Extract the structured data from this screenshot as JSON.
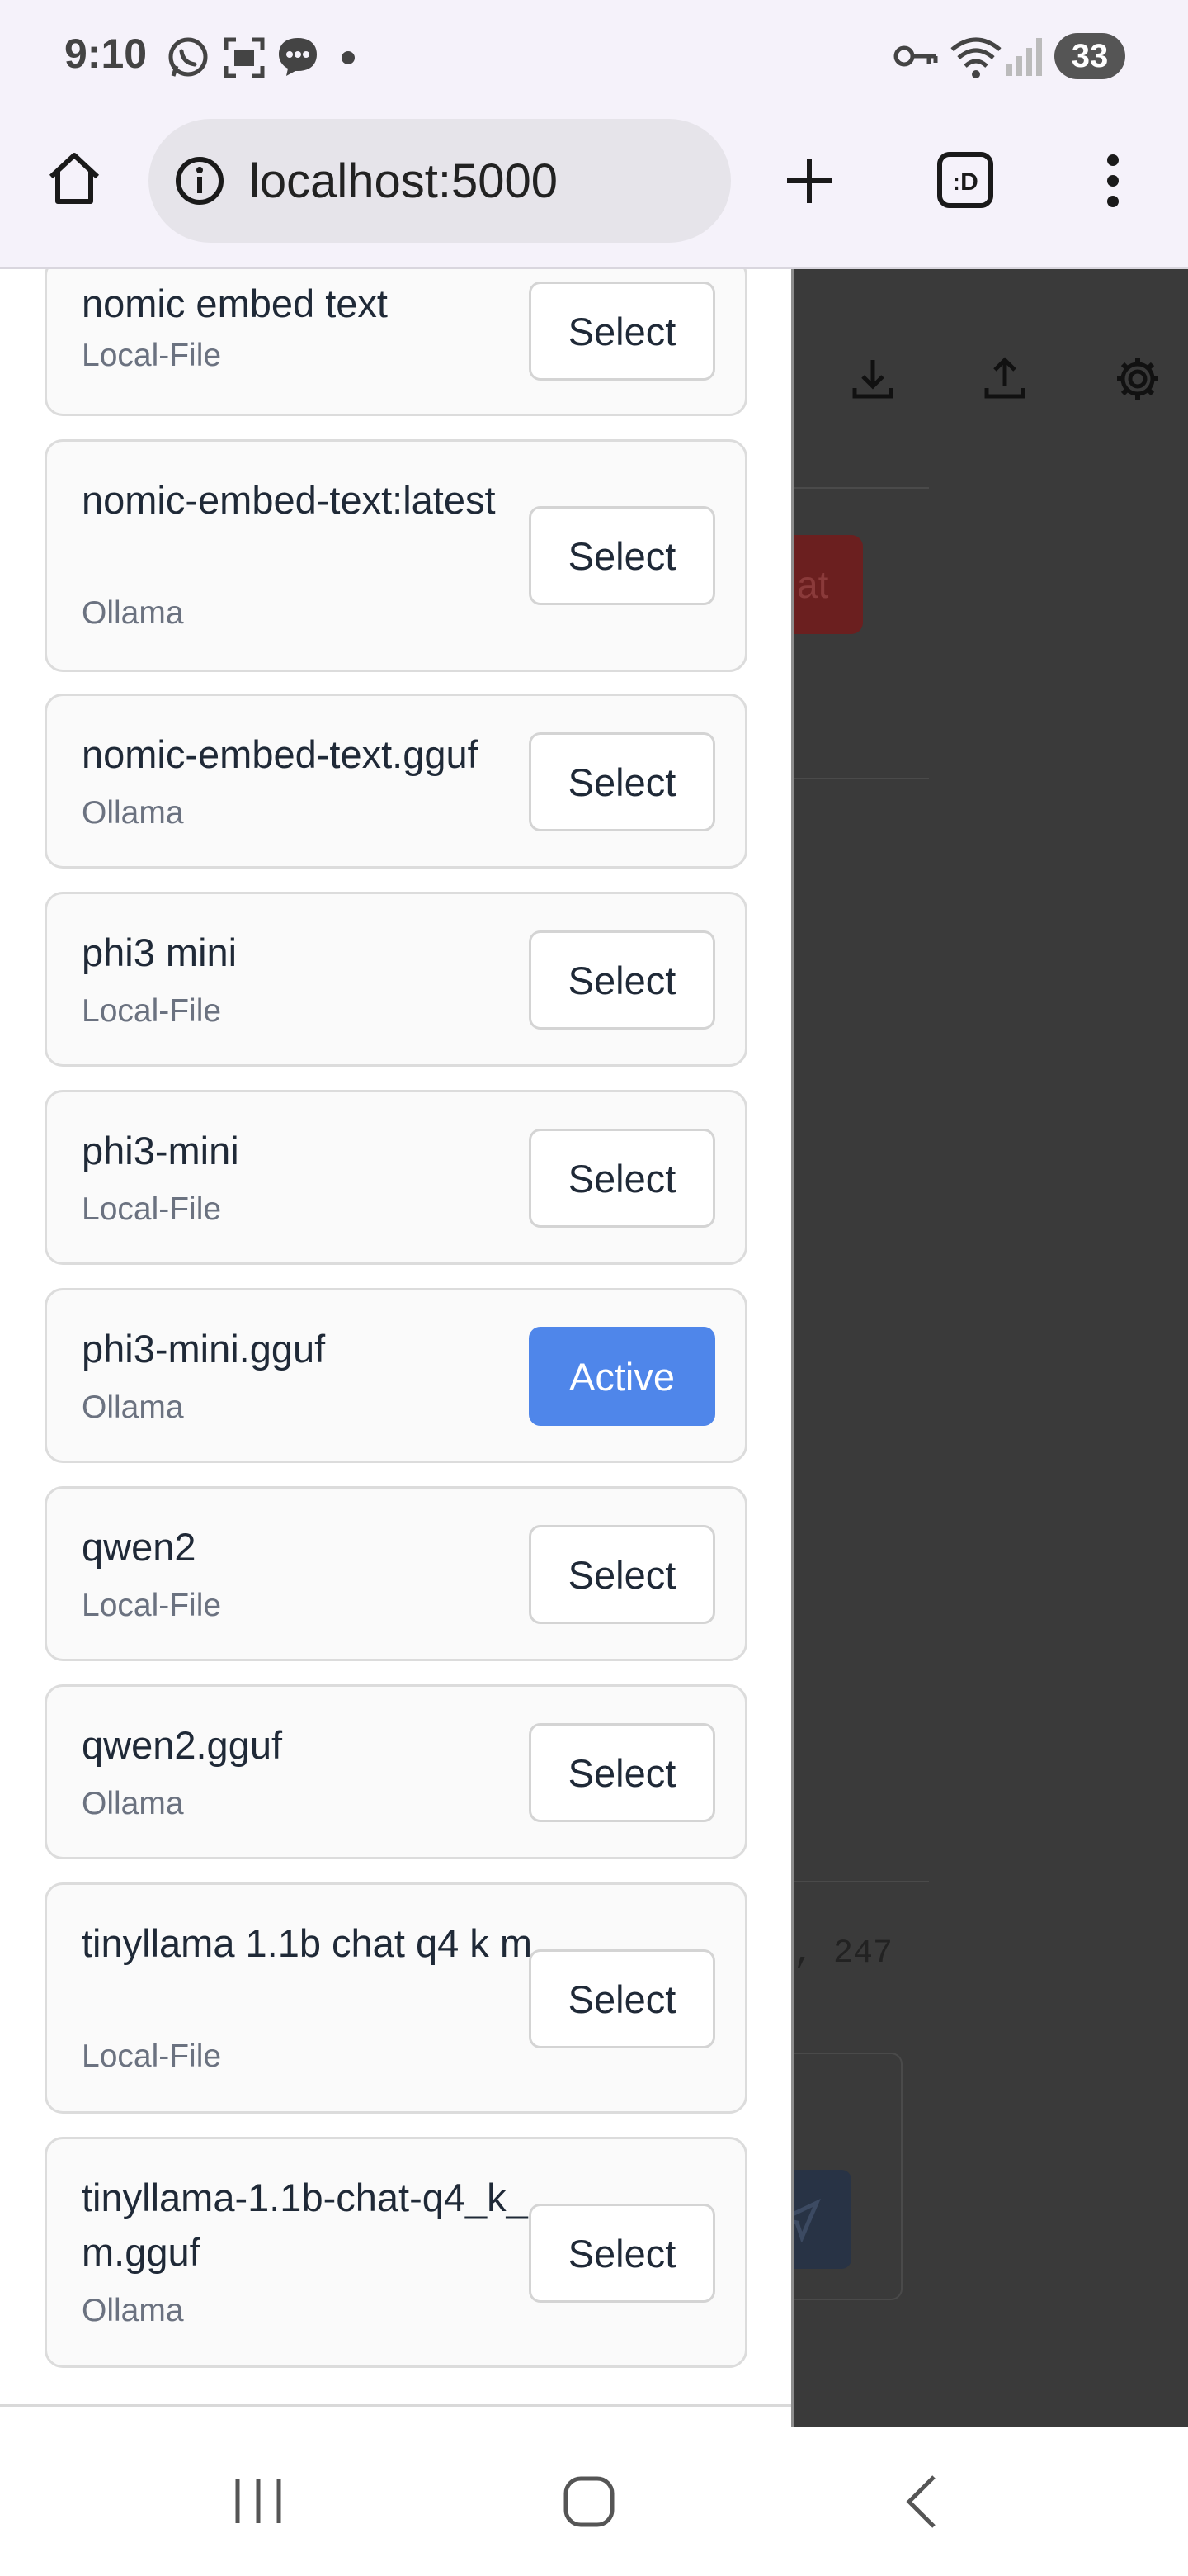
{
  "status_bar": {
    "time": "9:10",
    "battery": "33"
  },
  "browser": {
    "url": "localhost:5000"
  },
  "backdrop": {
    "partial_button_text": "at",
    "partial_count_text": ", 247"
  },
  "models": [
    {
      "name": "nomic embed text",
      "source": "Local-File",
      "button": "Select",
      "active": false
    },
    {
      "name": "nomic-embed-text:latest",
      "source": "Ollama",
      "button": "Select",
      "active": false
    },
    {
      "name": "nomic-embed-text.gguf",
      "source": "Ollama",
      "button": "Select",
      "active": false
    },
    {
      "name": "phi3 mini",
      "source": "Local-File",
      "button": "Select",
      "active": false
    },
    {
      "name": "phi3-mini",
      "source": "Local-File",
      "button": "Select",
      "active": false
    },
    {
      "name": "phi3-mini.gguf",
      "source": "Ollama",
      "button": "Active",
      "active": true
    },
    {
      "name": "qwen2",
      "source": "Local-File",
      "button": "Select",
      "active": false
    },
    {
      "name": "qwen2.gguf",
      "source": "Ollama",
      "button": "Select",
      "active": false
    },
    {
      "name": "tinyllama 1.1b chat q4 k m",
      "source": "Local-File",
      "button": "Select",
      "active": false
    },
    {
      "name": "tinyllama-1.1b-chat-q4_k_m.gguf",
      "source": "Ollama",
      "button": "Select",
      "active": false
    }
  ],
  "colors": {
    "active_button": "#4f86ea",
    "backdrop": "#3a3a3a",
    "delete_button": "#6b1f1f"
  },
  "icons": [
    "whatsapp-icon",
    "screenshot-icon",
    "message-icon",
    "key-icon",
    "wifi-icon",
    "signal-icon",
    "home-icon",
    "info-icon",
    "plus-icon",
    "tab-switcher-icon",
    "more-menu-icon",
    "download-icon",
    "upload-icon",
    "settings-icon",
    "send-icon",
    "recents-icon",
    "home-nav-icon",
    "back-icon"
  ]
}
